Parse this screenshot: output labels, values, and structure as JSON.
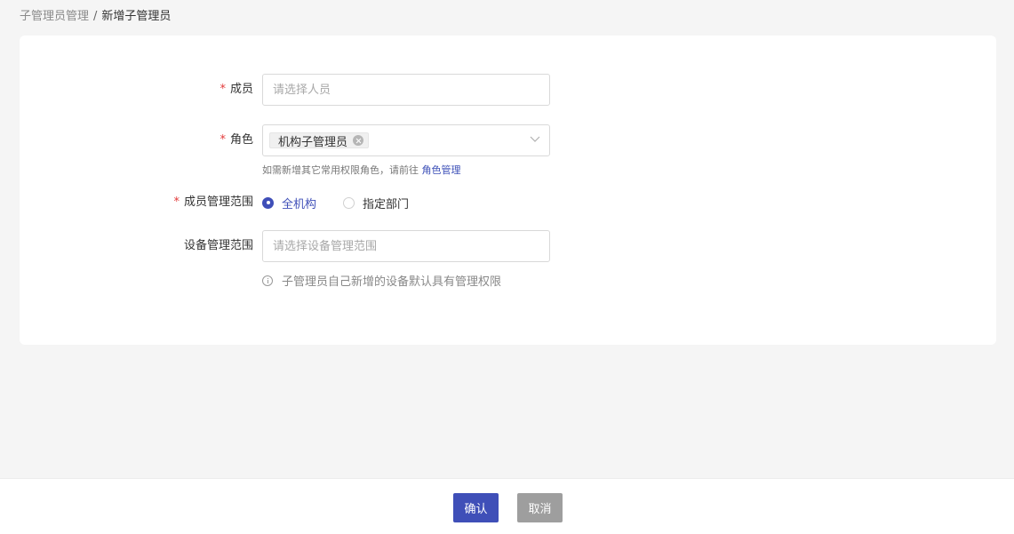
{
  "breadcrumb": {
    "parent": "子管理员管理",
    "separator": "/",
    "current": "新增子管理员"
  },
  "form": {
    "required_mark": "*",
    "member": {
      "label": "成员",
      "placeholder": "请选择人员",
      "value": ""
    },
    "role": {
      "label": "角色",
      "selected_tag": "机构子管理员",
      "help_text": "如需新增其它常用权限角色，请前往",
      "help_link": "角色管理"
    },
    "member_scope": {
      "label": "成员管理范围",
      "options": [
        {
          "label": "全机构",
          "checked": true
        },
        {
          "label": "指定部门",
          "checked": false
        }
      ]
    },
    "device_scope": {
      "label": "设备管理范围",
      "placeholder": "请选择设备管理范围",
      "value": "",
      "info_text": "子管理员自己新增的设备默认具有管理权限"
    }
  },
  "footer": {
    "confirm_label": "确认",
    "cancel_label": "取消"
  },
  "colors": {
    "primary": "#3f4fb8",
    "required": "#e23a3a",
    "cancel": "#9e9e9e"
  }
}
